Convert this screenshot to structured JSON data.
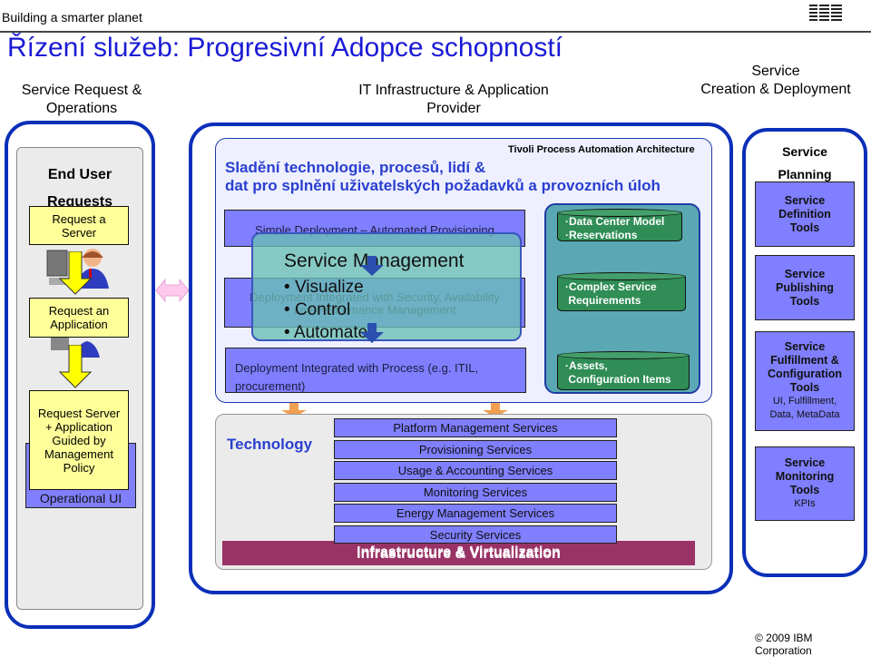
{
  "header": {
    "tagline": "Building a smarter planet",
    "logo": "IBM",
    "title": "Řízení služeb: Progresivní Adopce schopností"
  },
  "columns": {
    "left": [
      "Service Request &",
      "Operations"
    ],
    "middle": [
      "IT Infrastructure & Application",
      "Provider"
    ],
    "right": [
      "Service",
      "Creation & Deployment"
    ]
  },
  "left_panel": {
    "heading": [
      "End User",
      "Requests"
    ],
    "box1": [
      "Request a",
      "Server"
    ],
    "box2": [
      "Request an",
      "Application"
    ],
    "box3": [
      "Request Server",
      "+ Application",
      "Guided by",
      "Management Policy"
    ],
    "operational_ui": "Operational UI",
    "icons": [
      "user-at-computer-icon",
      "arrow-down-icon"
    ]
  },
  "center": {
    "architecture_label": "Tivoli Process Automation Architecture",
    "headline": [
      "Sladění technologie, procesů, lidí &",
      "dat pro splnění uživatelských požadavků a provozních úloh"
    ],
    "deploy_steps": [
      "Simple Deployment – Automated Provisioning",
      "Deployment Integrated with Security, Availability",
      "and Performance Management",
      "Deployment Integrated with  Process (e.g. ITIL,",
      "procurement)"
    ],
    "service_management": {
      "title": "Service Management",
      "bullets": [
        "Visualize",
        "Control",
        "Automate"
      ]
    },
    "data_stores": [
      [
        "Data Center Model",
        "Reservations"
      ],
      [
        "Complex Service",
        "Requirements"
      ],
      [
        "Assets,",
        "Configuration Items"
      ]
    ],
    "technology_label": "Technology",
    "services": [
      "Platform Management Services",
      "Provisioning Services",
      "Usage & Accounting Services",
      "Monitoring Services",
      "Energy Management Services",
      "Security Services"
    ],
    "infrastructure": "Infrastructure & Virtualization"
  },
  "right_panel": {
    "heading": [
      "Service",
      "Planning"
    ],
    "tools": [
      {
        "title": [
          "Service",
          "Definition",
          "Tools"
        ],
        "sub": ""
      },
      {
        "title": [
          "Service",
          "Publishing",
          "Tools"
        ],
        "sub": ""
      },
      {
        "title": [
          "Service",
          "Fulfillment &",
          "Configuration",
          "Tools"
        ],
        "sub": "UI, Fulfillment, Data, MetaData"
      },
      {
        "title": [
          "Service",
          "Monitoring",
          "Tools"
        ],
        "sub": "KPIs"
      }
    ]
  },
  "footer": {
    "copyright": "© 2009 IBM Corporation"
  },
  "colors": {
    "title_blue": "#1a1ad6",
    "frame_blue": "#0a2fb8",
    "bar_blue": "#7f7fff",
    "yellow": "#ffff99",
    "green": "#2f8d55",
    "infra": "#993366"
  }
}
